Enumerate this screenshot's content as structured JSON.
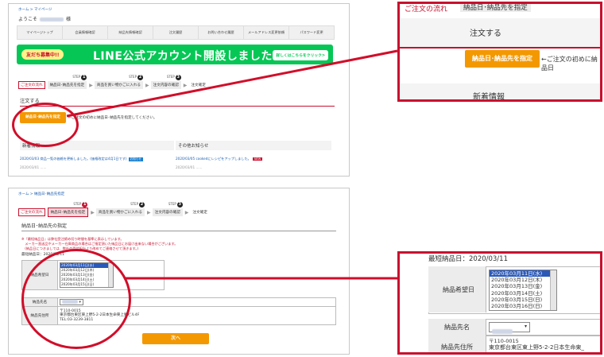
{
  "shot1": {
    "breadcrumb": "ホーム > マイページ",
    "welcome_prefix": "ようこそ",
    "welcome_suffix": "様",
    "menu": [
      "マイページトップ",
      "会員情報確認",
      "納品先情報確認",
      "注文履歴",
      "お問い合わせ履歴",
      "メールアドレス変更依頼",
      "パスワード変更"
    ],
    "banner": {
      "tag": "友だち募集中!!",
      "title": "LINE公式アカウント開設しました!",
      "button": "詳しくはこちらをクリック>"
    },
    "flow": {
      "label": "ご注文の流れ",
      "steps": [
        {
          "no": "1",
          "step": "STEP",
          "text": "納品日･納品先を指定"
        },
        {
          "no": "2",
          "step": "STEP",
          "text": "商品を買い物かごに入れる"
        },
        {
          "no": "3",
          "step": "STEP",
          "text": "注文内容の確認"
        },
        {
          "no": "",
          "step": "",
          "text": "注文確定"
        }
      ]
    },
    "order_heading": "注文する",
    "order_button": "納品日･納品先を指定",
    "order_note": "←ご注文の初めに納品日･納品先を指定してください。",
    "news_heading": "新着情報",
    "other_heading": "その他お知らせ",
    "news_line1": "2020/03/03 商品一覧の価格を更新しました。(価格改定は4月1日です)",
    "news_line2": "2020/03/01 ......",
    "other_line1": "2020/03/05 cookedにレシピをアップしました。",
    "other_line2": "2020/03/01 ......",
    "pill_new": "NEW",
    "pill_info": "お知らせ"
  },
  "shot2": {
    "breadcrumb": "ホーム > 納品日･納品先指定",
    "flow": {
      "label": "ご注文の流れ",
      "steps": [
        {
          "no": "1",
          "step": "STEP",
          "text": "納品日･納品先を指定"
        },
        {
          "no": "2",
          "step": "STEP",
          "text": "商品を買い物かごに入れる"
        },
        {
          "no": "3",
          "step": "STEP",
          "text": "注文内容の確認"
        },
        {
          "no": "",
          "step": "",
          "text": "注文確定"
        }
      ]
    },
    "form_title": "納品日･納品先の指定",
    "note1": "※『最短納品日』は弊社受注締め切り時間を基準に表示しています。",
    "note2": "　メーカー直送品やメーカー在庫商品の場合はご指定頂いた納品日にお届け出来ない場合がございます。",
    "note3": "　(納品日につきましては、弊社の受付担当より改めてご連絡させて頂きます。)",
    "earliest": "最短納品日：2020/03/11",
    "date_label": "納品希望日",
    "dates": [
      "2020年03月11日(水)",
      "2020年03月12日(木)",
      "2020年03月13日(金)",
      "2020年03月14日(土)",
      "2020年03月15日(日)"
    ],
    "dest_label": "納品先名",
    "addr_label": "納品先住所",
    "addr_zip": "〒110-0015",
    "addr_line": "東京都台東区東上野5-2-2日本生命東上野ビル4F",
    "addr_tel": "TEL:03-3239-3811",
    "next_button": "次へ"
  },
  "zoom1": {
    "top_flow": "ご注文の流れ",
    "top_step": "納品日･納品先を指定",
    "heading": "注文する",
    "button": "納品日･納品先を指定",
    "note": "←ご注文の初めに納品日",
    "news": "新着情報"
  },
  "zoom2": {
    "earliest": "最短納品日：2020/03/11",
    "date_label": "納品希望日",
    "dates": [
      "2020年03月11日(水)",
      "2020年03月12日(木)",
      "2020年03月13日(金)",
      "2020年03月14日(土)",
      "2020年03月15日(日)",
      "2020年03月16日(日)"
    ],
    "dest_label": "納品先名",
    "addr_label": "納品先住所",
    "addr_zip": "〒110-0015",
    "addr_line": "東京都台東区東上野5-2-2日本生命東_"
  },
  "colors": {
    "highlight": "#d10e2a",
    "button": "#f39800",
    "line_green": "#06c755"
  }
}
